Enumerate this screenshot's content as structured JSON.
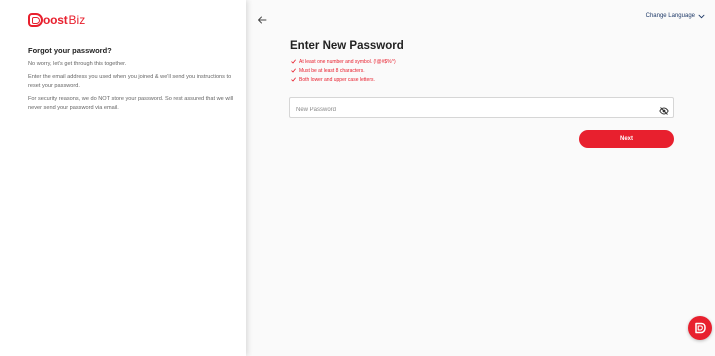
{
  "brand": {
    "name_part1": "oost",
    "name_part2": "Biz",
    "accent": "#e8202e"
  },
  "help": {
    "title": "Forgot your password?",
    "line1": "No worry, let's get through this together.",
    "line2": "Enter the email address you used when you joined & we'll send you instructions to reset your password.",
    "line3": "For security reasons, we do NOT store your password. So rest assured that we will never send your password via email."
  },
  "header": {
    "language_label": "Change Language"
  },
  "form": {
    "title": "Enter New Password",
    "rules": [
      "At least one number and symbol. (!@#$%^)",
      "Must be at least 8 characters.",
      "Both lower and upper case letters."
    ],
    "password_placeholder": "New Password",
    "next_label": "Next"
  },
  "icons": {
    "back": "arrow-left-icon",
    "language": "chevron-down-icon",
    "eye": "eye-off-icon",
    "chat": "chat-icon",
    "check": "check-icon"
  }
}
